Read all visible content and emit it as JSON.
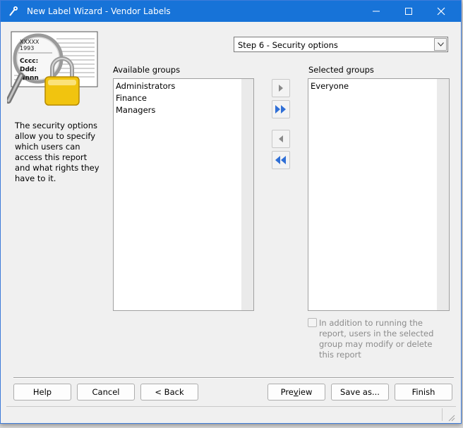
{
  "window": {
    "title": "New Label Wizard - Vendor Labels"
  },
  "titlebar_icons": {
    "app": "wizard-wand-icon",
    "minimize": "minimize-icon",
    "maximize": "maximize-icon",
    "close": "close-icon"
  },
  "sidebar": {
    "illustration": "report-magnifier-lock-icon",
    "illustration_text": [
      "XXXXX",
      "1993",
      "Cccc:",
      "Ddd:",
      "Nnnn"
    ],
    "description": "The security options allow you to specify which users can access this report and what rights they have to it."
  },
  "step_select": {
    "value": "Step 6 - Security options",
    "icon": "chevron-down-icon"
  },
  "available": {
    "label": "Available groups",
    "items": [
      "Administrators",
      "Finance",
      "Managers"
    ]
  },
  "selected": {
    "label": "Selected groups",
    "items": [
      "Everyone"
    ]
  },
  "move_buttons": {
    "add_one": "arrow-right-icon",
    "add_all": "double-arrow-right-icon",
    "remove_one": "arrow-left-icon",
    "remove_all": "double-arrow-left-icon"
  },
  "modify_option": {
    "checked": false,
    "enabled": false,
    "label": "In addition to running the report, users in the selected group may modify or delete this report"
  },
  "buttons": {
    "help": "Help",
    "cancel": "Cancel",
    "back": "< Back",
    "preview_pre": "Pre",
    "preview_accel": "v",
    "preview_post": "iew",
    "save_as": "Save as...",
    "finish": "Finish"
  },
  "colors": {
    "titlebar": "#1773d8",
    "window_bg": "#f0f0f0",
    "arrow_blue": "#2f6fd6",
    "arrow_gray": "#8a8a8a"
  }
}
